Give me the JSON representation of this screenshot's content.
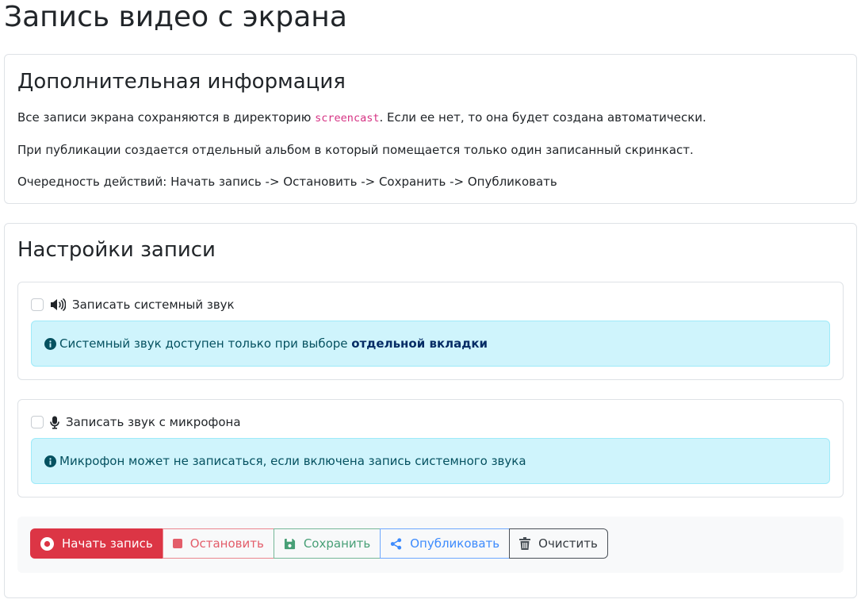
{
  "page": {
    "title": "Запись видео с экрана"
  },
  "info": {
    "heading": "Дополнительная информация",
    "line1_before": "Все записи экрана сохраняются в директорию ",
    "line1_code": "screencast",
    "line1_after": ". Если ее нет, то она будет создана автоматически.",
    "line2": "При публикации создается отдельный альбом в который помещается только один записанный скринкаст.",
    "line3": "Очередность действий: Начать запись -> Остановить -> Сохранить -> Опубликовать"
  },
  "settings": {
    "heading": "Настройки записи",
    "system_audio": {
      "label": "Записать системный звук",
      "checked": false,
      "icon": "volume-icon",
      "alert_before": "Системный звук доступен только при выборе ",
      "alert_bold": "отдельной вкладки"
    },
    "mic_audio": {
      "label": "Записать звук с микрофона",
      "checked": false,
      "icon": "microphone-icon",
      "alert_text": "Микрофон может не записаться, если включена запись системного звука"
    }
  },
  "toolbar": {
    "start_label": "Начать запись",
    "stop_label": "Остановить",
    "save_label": "Сохранить",
    "publish_label": "Опубликовать",
    "clear_label": "Очистить"
  },
  "colors": {
    "danger": "#dc3545",
    "info_bg": "#cff4fc",
    "success": "#479f76",
    "primary": "#3d8bfd",
    "dark": "#343a40"
  }
}
